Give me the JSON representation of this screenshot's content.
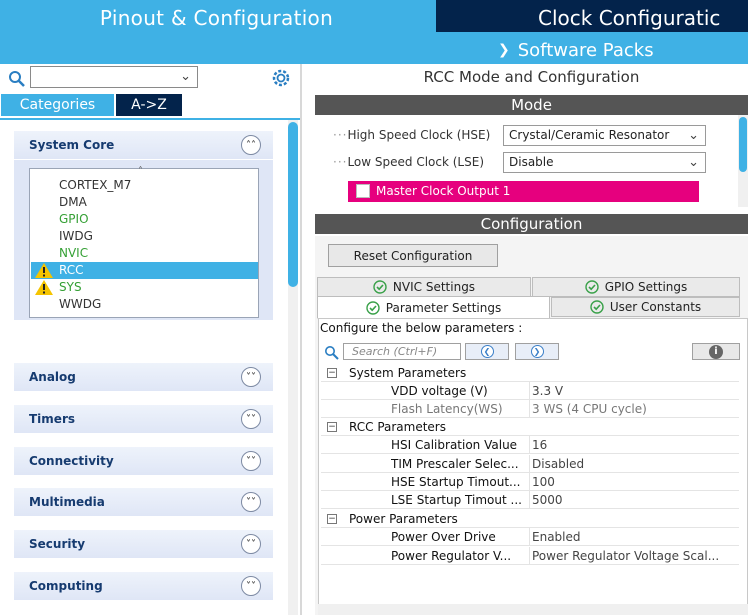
{
  "header": {
    "tab_pinout": "Pinout & Configuration",
    "tab_clock": "Clock Configuratic",
    "software_packs": "Software Packs"
  },
  "left": {
    "search_value": "",
    "categories_label": "Categories",
    "az_label": "A->Z",
    "system_core": {
      "title": "System Core",
      "items": [
        {
          "label": "CORTEX_M7",
          "status": "normal"
        },
        {
          "label": "DMA",
          "status": "normal"
        },
        {
          "label": "GPIO",
          "status": "green"
        },
        {
          "label": "IWDG",
          "status": "normal"
        },
        {
          "label": "NVIC",
          "status": "green"
        },
        {
          "label": "RCC",
          "status": "warning-selected"
        },
        {
          "label": "SYS",
          "status": "warning-green"
        },
        {
          "label": "WWDG",
          "status": "normal"
        }
      ]
    },
    "sections": [
      "Analog",
      "Timers",
      "Connectivity",
      "Multimedia",
      "Security",
      "Computing"
    ]
  },
  "right": {
    "title": "RCC Mode and Configuration",
    "mode_bar": "Mode",
    "hse_label": "High Speed Clock (HSE)",
    "hse_value": "Crystal/Ceramic Resonator",
    "lse_label": "Low Speed Clock (LSE)",
    "lse_value": "Disable",
    "mco_label": "Master Clock Output 1",
    "configuration_bar": "Configuration",
    "reset_label": "Reset Configuration",
    "tabs": {
      "nvic": "NVIC Settings",
      "gpio": "GPIO Settings",
      "parameter": "Parameter Settings",
      "user_constants": "User Constants"
    },
    "params_heading": "Configure the below parameters :",
    "search_placeholder": "Search (Ctrl+F)",
    "params": [
      {
        "type": "group",
        "label": "System Parameters"
      },
      {
        "type": "row",
        "key": "VDD voltage (V)",
        "value": "3.3 V",
        "gray": false
      },
      {
        "type": "row",
        "key": "Flash Latency(WS)",
        "value": "3 WS (4 CPU cycle)",
        "gray": true
      },
      {
        "type": "group",
        "label": "RCC Parameters"
      },
      {
        "type": "row",
        "key": "HSI Calibration Value",
        "value": "16",
        "gray": false
      },
      {
        "type": "row",
        "key": "TIM Prescaler Selec...",
        "value": "Disabled",
        "gray": false
      },
      {
        "type": "row",
        "key": "HSE Startup Timout...",
        "value": "100",
        "gray": false
      },
      {
        "type": "row",
        "key": "LSE Startup Timout ...",
        "value": "5000",
        "gray": false
      },
      {
        "type": "group",
        "label": "Power Parameters"
      },
      {
        "type": "row",
        "key": "Power Over Drive",
        "value": "Enabled",
        "gray": false
      },
      {
        "type": "row",
        "key": "Power Regulator V...",
        "value": "Power Regulator Voltage Scal...",
        "gray": false
      }
    ]
  },
  "colors": {
    "accent": "#3fb1e5",
    "dark_navy": "#03234b",
    "magenta": "#e6007e",
    "green_status": "#35a035",
    "warning": "#f5c400"
  }
}
